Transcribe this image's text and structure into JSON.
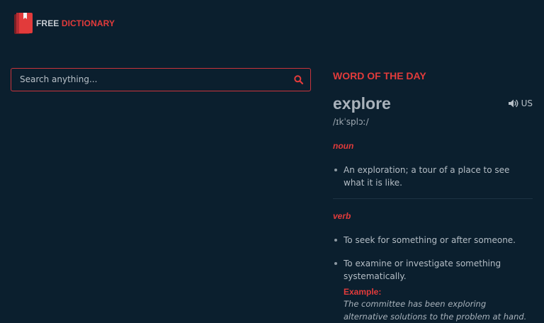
{
  "brand": {
    "free": "FREE",
    "dictionary": "DICTIONARY",
    "accent_color": "#e23b3b",
    "background_color": "#0b1f2e"
  },
  "search": {
    "placeholder": "Search anything...",
    "value": "",
    "button_icon": "search-icon"
  },
  "word_of_the_day": {
    "heading": "WORD OF THE DAY",
    "word": "explore",
    "phonetic": "/ɪkˈsplɔː/",
    "audio": {
      "icon": "speaker-icon",
      "label": "US"
    },
    "meanings": [
      {
        "part_of_speech": "noun",
        "definitions": [
          {
            "text": "An exploration; a tour of a place to see what it is like."
          }
        ]
      },
      {
        "part_of_speech": "verb",
        "definitions": [
          {
            "text": "To seek for something or after someone."
          },
          {
            "text": "To examine or investigate something systematically.",
            "example_label": "Example:",
            "example": "The committee has been exploring alternative solutions to the problem at hand."
          }
        ]
      }
    ]
  }
}
